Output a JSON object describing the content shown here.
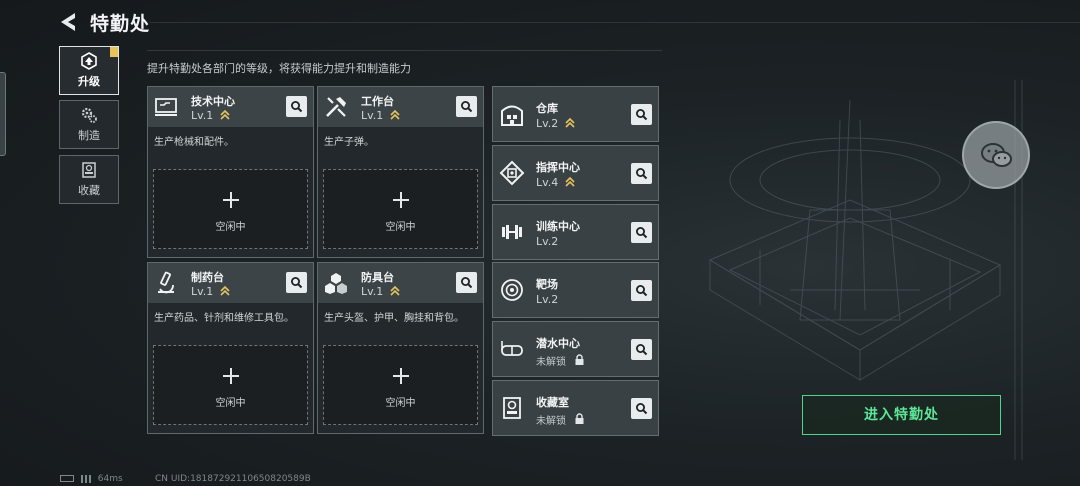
{
  "header": {
    "title": "特勤处"
  },
  "sidebar": {
    "tabs": [
      {
        "label": "升级",
        "icon": "upgrade-icon",
        "active": true
      },
      {
        "label": "制造",
        "icon": "gears-icon",
        "active": false
      },
      {
        "label": "收藏",
        "icon": "collection-icon",
        "active": false
      }
    ]
  },
  "description": "提升特勤处各部门的等级，将获得能力提升和制造能力",
  "departments": [
    {
      "name": "技术中心",
      "level": "Lv.1",
      "icon": "tech-center-icon",
      "desc": "生产枪械和配件。",
      "slot_label": "空闲中",
      "upgradable": true
    },
    {
      "name": "工作台",
      "level": "Lv.1",
      "icon": "workbench-icon",
      "desc": "生产子弹。",
      "slot_label": "空闲中",
      "upgradable": true
    },
    {
      "name": "制药台",
      "level": "Lv.1",
      "icon": "pharmacy-icon",
      "desc": "生产药品、针剂和维修工具包。",
      "slot_label": "空闲中",
      "upgradable": true
    },
    {
      "name": "防具台",
      "level": "Lv.1",
      "icon": "armor-bench-icon",
      "desc": "生产头盔、护甲、胸挂和背包。",
      "slot_label": "空闲中",
      "upgradable": true
    }
  ],
  "facilities": [
    {
      "name": "仓库",
      "level": "Lv.2",
      "icon": "warehouse-icon",
      "upgradable": true,
      "locked": false
    },
    {
      "name": "指挥中心",
      "level": "Lv.4",
      "icon": "command-center-icon",
      "upgradable": true,
      "locked": false
    },
    {
      "name": "训练中心",
      "level": "Lv.2",
      "icon": "training-icon",
      "upgradable": false,
      "locked": false
    },
    {
      "name": "靶场",
      "level": "Lv.2",
      "icon": "range-icon",
      "upgradable": false,
      "locked": false
    },
    {
      "name": "潜水中心",
      "level": "未解锁",
      "icon": "dive-center-icon",
      "upgradable": false,
      "locked": true
    },
    {
      "name": "收藏室",
      "level": "未解锁",
      "icon": "collection-room-icon",
      "upgradable": false,
      "locked": true
    }
  ],
  "enter_button": "进入特勤处",
  "status": {
    "ping": "64ms",
    "uid": "CN UID:18187292110650820589B"
  },
  "colors": {
    "accent_green": "#5ee598",
    "upgrade_gold": "#e7c35c",
    "panel": "#3a4145"
  }
}
